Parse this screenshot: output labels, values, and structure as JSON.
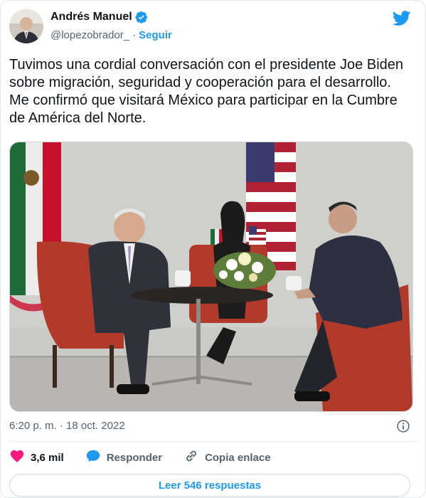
{
  "author": {
    "display_name": "Andrés Manuel",
    "handle": "@lopezobrador_",
    "separator": "·",
    "follow_label": "Seguir",
    "verified": true
  },
  "tweet": {
    "text": "Tuvimos una cordial conversación con el presidente Joe Biden sobre migración, seguridad y cooperación para el desarrollo. Me confirmó que visitará México para participar en la Cumbre de América del Norte.",
    "timestamp": "6:20 p. m. · 18 oct. 2022"
  },
  "actions": {
    "likes_count": "3,6 mil",
    "reply_label": "Responder",
    "copy_link_label": "Copia enlace",
    "read_replies_label": "Leer 546 respuestas"
  },
  "colors": {
    "accent": "#1d9bf0",
    "like": "#f91880",
    "muted": "#536471",
    "text": "#0f1419"
  },
  "icons": [
    "verified-badge-icon",
    "twitter-bird-icon",
    "info-icon",
    "heart-icon",
    "reply-bubble-icon",
    "link-icon"
  ]
}
